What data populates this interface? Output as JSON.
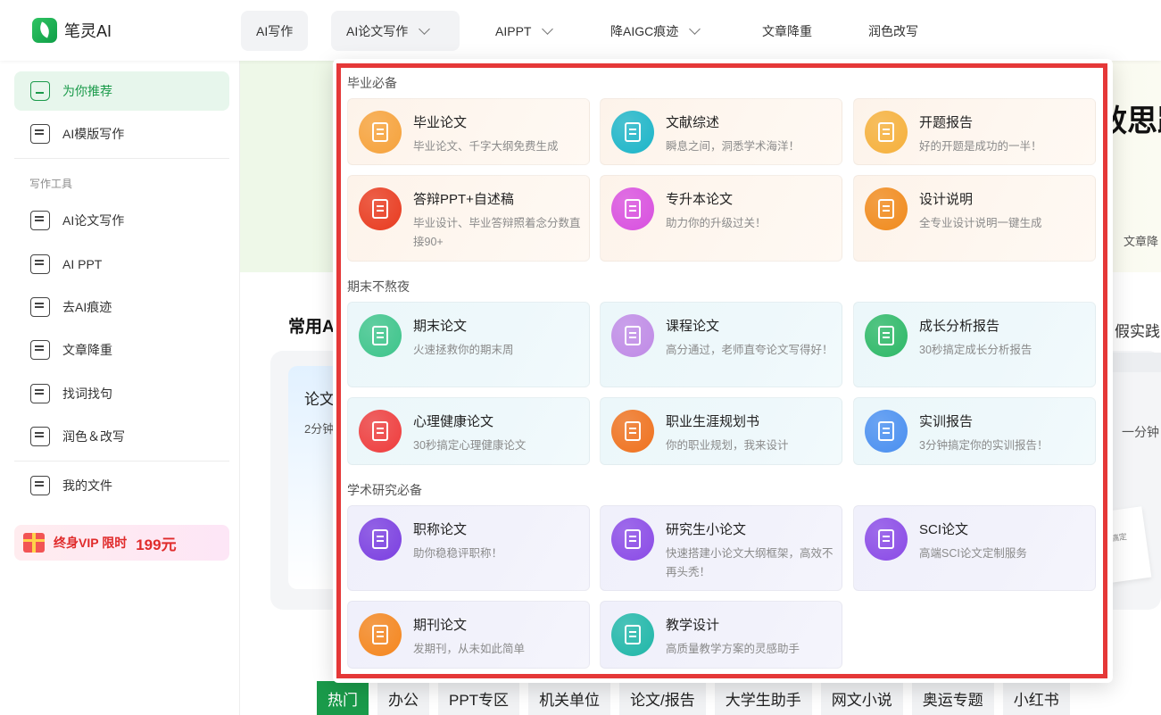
{
  "header": {
    "logo_text": "笔灵AI",
    "nav": [
      {
        "label": "AI写作"
      },
      {
        "label": "AI论文写作"
      },
      {
        "label": "AIPPT"
      },
      {
        "label": "降AIGC痕迹"
      },
      {
        "label": "文章降重"
      },
      {
        "label": "润色改写"
      }
    ]
  },
  "sidebar": {
    "top_items": [
      {
        "label": "为你推荐",
        "icon": "home-icon"
      },
      {
        "label": "AI模版写作",
        "icon": "template-icon"
      }
    ],
    "section_label": "写作工具",
    "tool_items": [
      {
        "label": "AI论文写作",
        "icon": "paper-edit-icon"
      },
      {
        "label": "AI PPT",
        "icon": "ppt-icon"
      },
      {
        "label": "去AI痕迹",
        "icon": "chart-check-icon"
      },
      {
        "label": "文章降重",
        "icon": "doc-down-icon"
      },
      {
        "label": "找词找句",
        "icon": "search-doc-icon"
      },
      {
        "label": "润色＆改写",
        "icon": "magic-pen-icon"
      }
    ],
    "files_item": {
      "label": "我的文件",
      "icon": "file-icon"
    },
    "vip": {
      "text": "终身VIP 限时",
      "price": "199元"
    }
  },
  "background": {
    "banner_text": "效思路",
    "banner_tag": "文章降",
    "section_title": "常用AI",
    "card_title": "论文",
    "card_sub": "2分钟",
    "right_title": "假实践",
    "right_sub": "一分钟",
    "right_note": "搞定",
    "tabs": [
      "热门",
      "办公",
      "PPT专区",
      "机关单位",
      "论文/报告",
      "大学生助手",
      "网文小说",
      "奥运专题",
      "小红书"
    ]
  },
  "dropdown": {
    "groups": [
      {
        "title": "毕业必备",
        "items": [
          {
            "title": "毕业论文",
            "desc": "毕业论文、千字大纲免费生成",
            "icon": "graduation-paper-icon",
            "color": "#f6a23b"
          },
          {
            "title": "文献综述",
            "desc": "瞬息之间，洞悉学术海洋！",
            "icon": "literature-icon",
            "color": "#1bb5c9"
          },
          {
            "title": "开题报告",
            "desc": "好的开题是成功的一半！",
            "icon": "proposal-icon",
            "color": "#f5b03b"
          },
          {
            "title": "答辩PPT+自述稿",
            "desc": "毕业设计、毕业答辩照着念分数直接90+",
            "icon": "ppt-p-icon",
            "color": "#e83a1f"
          },
          {
            "title": "专升本论文",
            "desc": "助力你的升级过关！",
            "icon": "upgrade-icon",
            "color": "#d84fe0"
          },
          {
            "title": "设计说明",
            "desc": "全专业设计说明一键生成",
            "icon": "ruler-icon",
            "color": "#f08a1c"
          }
        ]
      },
      {
        "title": "期末不熬夜",
        "items": [
          {
            "title": "期末论文",
            "desc": "火速拯救你的期末周",
            "icon": "pen-edit-icon",
            "color": "#3dc48a"
          },
          {
            "title": "课程论文",
            "desc": "高分通过，老师直夸论文写得好！",
            "icon": "course-icon",
            "color": "#c08ae6"
          },
          {
            "title": "成长分析报告",
            "desc": "30秒搞定成长分析报告",
            "icon": "growth-chart-icon",
            "color": "#2db866"
          },
          {
            "title": "心理健康论文",
            "desc": "30秒搞定心理健康论文",
            "icon": "heart-icon",
            "color": "#ef3c3c"
          },
          {
            "title": "职业生涯规划书",
            "desc": "你的职业规划，我来设计",
            "icon": "career-icon",
            "color": "#f0711d"
          },
          {
            "title": "实训报告",
            "desc": "3分钟搞定你的实训报告！",
            "icon": "training-report-icon",
            "color": "#4a8ff0"
          }
        ]
      },
      {
        "title": "学术研究必备",
        "items": [
          {
            "title": "职称论文",
            "desc": "助你稳稳评职称！",
            "icon": "title-paper-icon",
            "color": "#7b3fe0"
          },
          {
            "title": "研究生小论文",
            "desc": "快速搭建小论文大纲框架，高效不再头秃！",
            "icon": "grad-paper-icon",
            "color": "#8a4ae6"
          },
          {
            "title": "SCI论文",
            "desc": "高端SCI论文定制服务",
            "icon": "sci-icon",
            "color": "#8a4ae6"
          },
          {
            "title": "期刊论文",
            "desc": "发期刊，从未如此简单",
            "icon": "journal-icon",
            "color": "#f5861d"
          },
          {
            "title": "教学设计",
            "desc": "高质量教学方案的灵感助手",
            "icon": "teaching-icon",
            "color": "#1fb7a8"
          }
        ]
      }
    ]
  }
}
